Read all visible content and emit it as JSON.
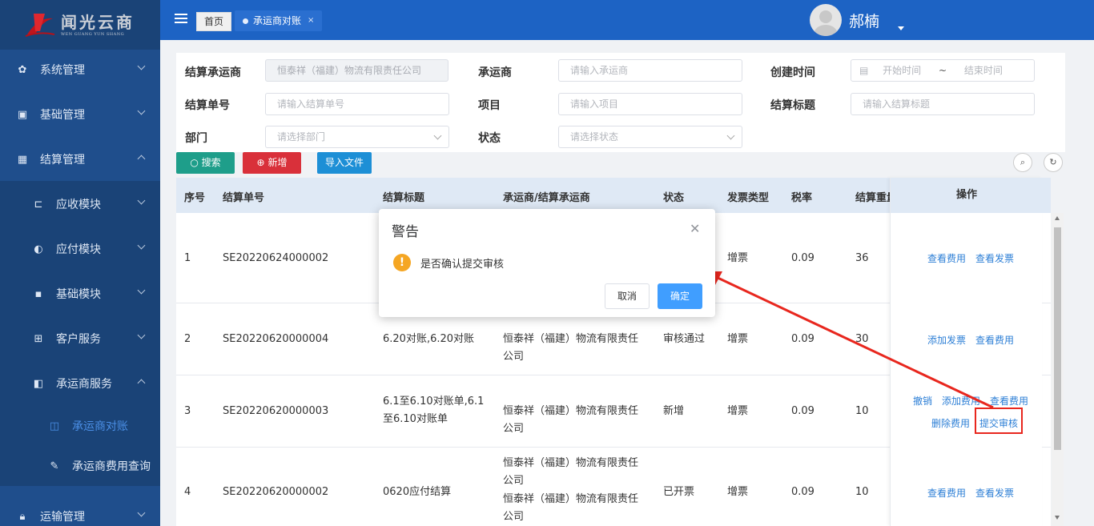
{
  "logo": {
    "cn": "闻光云商",
    "en": "WEN GUANG YUN SHANG"
  },
  "sidebar": {
    "items": [
      {
        "label": "系统管理",
        "icon": "gear-icon",
        "expanded": false
      },
      {
        "label": "基础管理",
        "icon": "chip-icon",
        "expanded": false
      },
      {
        "label": "结算管理",
        "icon": "grid-icon",
        "expanded": true
      },
      {
        "label": "应收模块",
        "icon": "plug-icon",
        "expanded": false
      },
      {
        "label": "应付模块",
        "icon": "palette-icon",
        "expanded": false
      },
      {
        "label": "基础模块",
        "icon": "image-icon",
        "expanded": false
      },
      {
        "label": "客户服务",
        "icon": "table-icon",
        "expanded": false
      },
      {
        "label": "承运商服务",
        "icon": "book-icon",
        "expanded": true
      },
      {
        "label": "承运商对账",
        "icon": "book-outline-icon",
        "active": true
      },
      {
        "label": "承运商费用查询",
        "icon": "edit-icon"
      },
      {
        "label": "运输管理",
        "icon": "lock-icon",
        "expanded": false
      }
    ]
  },
  "topbar": {
    "home_tab": "首页",
    "active_tab": "承运商对账",
    "tab_close": "×",
    "username": "郝楠"
  },
  "filters": {
    "settle_carrier_label": "结算承运商",
    "settle_carrier_value": "恒泰祥（福建）物流有限责任公司",
    "carrier_label": "承运商",
    "carrier_placeholder": "请输入承运商",
    "created_label": "创建时间",
    "start_placeholder": "开始时间",
    "range_sep": "~",
    "end_placeholder": "结束时间",
    "settle_no_label": "结算单号",
    "settle_no_placeholder": "请输入结算单号",
    "project_label": "项目",
    "project_placeholder": "请输入项目",
    "settle_title_label": "结算标题",
    "settle_title_placeholder": "请输入结算标题",
    "dept_label": "部门",
    "dept_placeholder": "请选择部门",
    "status_label": "状态",
    "status_placeholder": "请选择状态"
  },
  "toolbar": {
    "search": "搜索",
    "add": "新增",
    "import": "导入文件"
  },
  "table": {
    "headers": [
      "序号",
      "结算单号",
      "结算标题",
      "承运商/结算承运商",
      "状态",
      "发票类型",
      "税率",
      "结算重量",
      "操作"
    ],
    "rows": [
      {
        "no": "1",
        "code": "SE20220624000002",
        "title": "",
        "carrier": "",
        "status": "",
        "invoice": "增票",
        "tax": "0.09",
        "weight": "36",
        "ops": [
          "查看费用",
          "查看发票"
        ]
      },
      {
        "no": "2",
        "code": "SE20220620000004",
        "title": "6.20对账,6.20对账",
        "carrier": "恒泰祥（福建）物流有限责任公司",
        "status": "审核通过",
        "invoice": "增票",
        "tax": "0.09",
        "weight": "30",
        "ops": [
          "添加发票",
          "查看费用"
        ]
      },
      {
        "no": "3",
        "code": "SE20220620000003",
        "title": "6.1至6.10对账单,6.1至6.10对账单",
        "carrier": "恒泰祥（福建）物流有限责任公司",
        "status": "新增",
        "invoice": "增票",
        "tax": "0.09",
        "weight": "10",
        "ops": [
          "撤销",
          "添加费用",
          "查看费用",
          "删除费用",
          "提交审核"
        ]
      },
      {
        "no": "4",
        "code": "SE20220620000002",
        "title": "0620应付结算",
        "carrier": "恒泰祥（福建）物流有限责任公司",
        "carrier2": "恒泰祥（福建）物流有限责任公司",
        "status": "已开票",
        "invoice": "增票",
        "tax": "0.09",
        "weight": "10",
        "ops": [
          "查看费用",
          "查看发票"
        ]
      }
    ]
  },
  "dialog": {
    "title": "警告",
    "message": "是否确认提交审核",
    "cancel": "取消",
    "confirm": "确定"
  },
  "colors": {
    "sidebar": "#1f4e8c",
    "topbar": "#1d63c4",
    "primary": "#409eff",
    "warning": "#f5a623",
    "annotation": "#e8271e"
  }
}
